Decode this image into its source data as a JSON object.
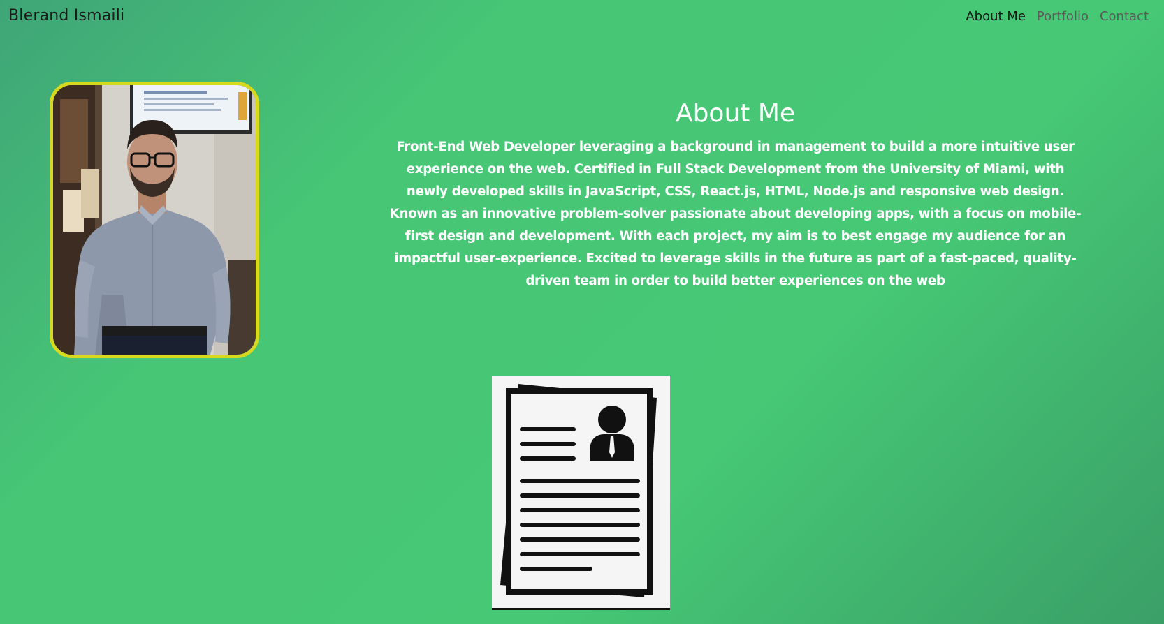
{
  "navbar": {
    "brand": "Blerand Ismaili",
    "links": [
      {
        "label": "About Me",
        "active": true
      },
      {
        "label": "Portfolio",
        "active": false
      },
      {
        "label": "Contact",
        "active": false
      }
    ]
  },
  "about": {
    "title": "About Me",
    "bio": "Front-End Web Developer leveraging a background in management to build a more intuitive user experience on the web. Certified in Full Stack Development from the University of Miami, with newly developed skills in JavaScript, CSS, React.js, HTML, Node.js and responsive web design. Known as an innovative problem-solver passionate about developing apps, with a focus on mobile-first design and development. With each project, my aim is to best engage my audience for an impactful user-experience. Excited to leverage skills in the future as part of a fast-paced, quality-driven team in order to build better experiences on the web"
  },
  "resume": {
    "icon": "resume-document-icon"
  },
  "colors": {
    "background_green": "#47c776",
    "frame_yellow": "#d7d91f",
    "text_white": "#ffffff",
    "nav_active": "#151515",
    "nav_inactive": "#5c5c5c"
  }
}
